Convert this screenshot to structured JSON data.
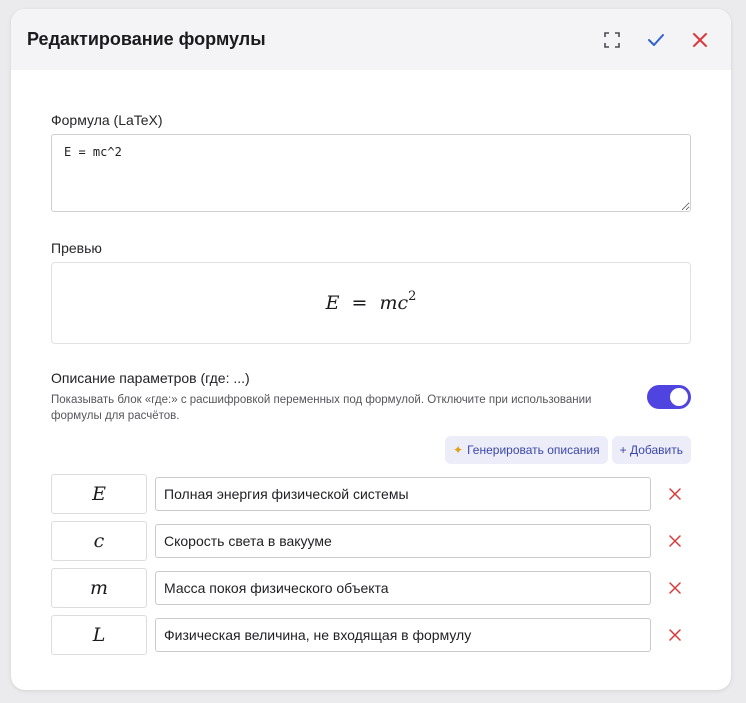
{
  "dialog": {
    "title": "Редактирование формулы",
    "icons": {
      "fullscreen": "fullscreen-icon",
      "confirm": "check-icon",
      "close": "close-icon"
    }
  },
  "formula": {
    "label": "Формула (LaTeX)",
    "value": "E = mc^2"
  },
  "preview": {
    "label": "Превью",
    "lhs": "E",
    "eq": "=",
    "rhs": "mc",
    "exponent": "2"
  },
  "params": {
    "title": "Описание параметров (где: ...)",
    "description": "Показывать блок «где:» с расшифровкой переменных под формулой. Отключите при использовании формулы для расчётов.",
    "toggle_on": true,
    "generate_label": "Генерировать описания",
    "add_label": "+ Добавить",
    "items": [
      {
        "symbol": "E",
        "description": "Полная энергия физической системы"
      },
      {
        "symbol": "c",
        "description": "Скорость света в вакууме"
      },
      {
        "symbol": "m",
        "description": "Масса покоя физического объекта"
      },
      {
        "symbol": "L",
        "description": "Физическая величина, не входящая в формулу"
      }
    ]
  },
  "colors": {
    "accent": "#4f44e0",
    "confirm": "#2f5fd0",
    "danger": "#d93a3a",
    "header_bg": "#f4f4f6"
  }
}
